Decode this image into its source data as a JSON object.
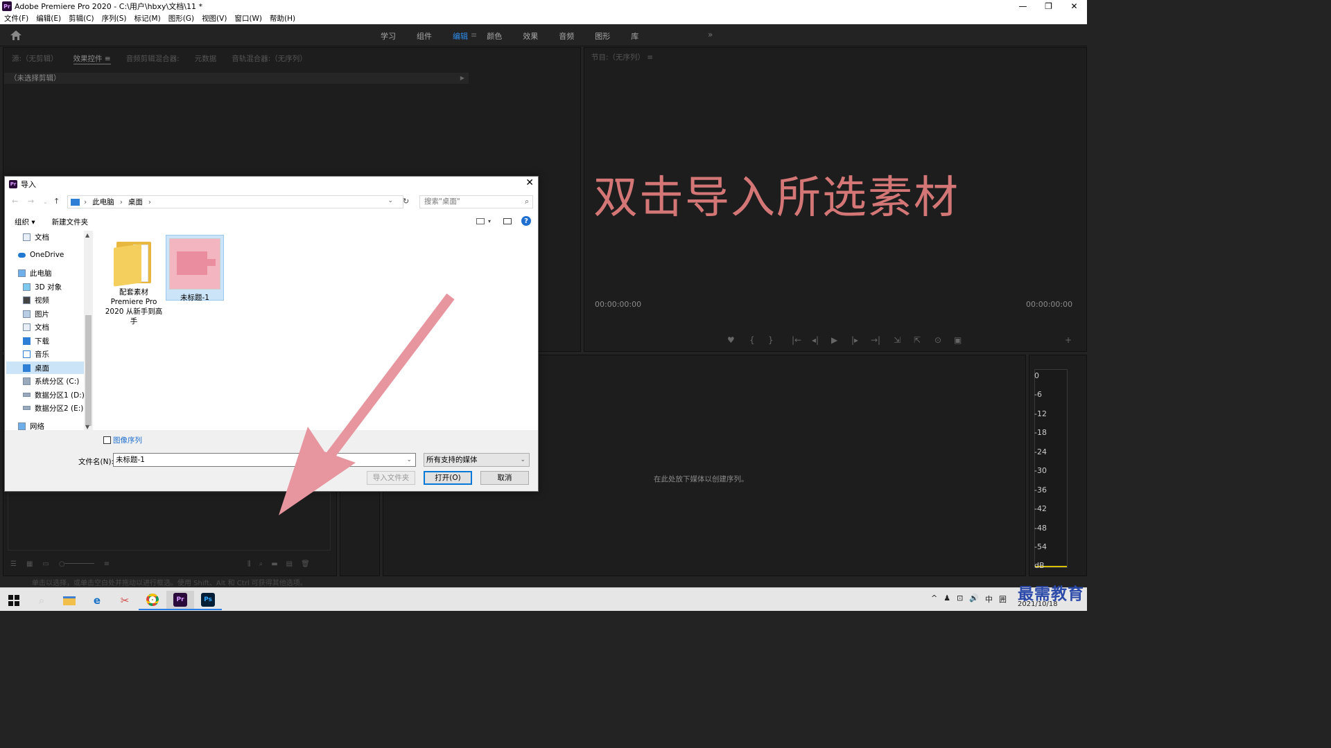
{
  "window": {
    "title": "Adobe Premiere Pro 2020 - C:\\用户\\hbxy\\文档\\11 *",
    "app_logo": "Pr",
    "controls": [
      "—",
      "❐",
      "✕"
    ]
  },
  "menu": [
    "文件(F)",
    "编辑(E)",
    "剪辑(C)",
    "序列(S)",
    "标记(M)",
    "图形(G)",
    "视图(V)",
    "窗口(W)",
    "帮助(H)"
  ],
  "workspaces": {
    "tabs": [
      "学习",
      "组件",
      "编辑",
      "颜色",
      "效果",
      "音频",
      "图形",
      "库"
    ],
    "active": "编辑",
    "active_marker": "≡",
    "more": "»"
  },
  "source_panel": {
    "tabs": [
      "源:（无剪辑）",
      "效果控件 ≡",
      "音频剪辑混合器:",
      "元数据",
      "音轨混合器:（无序列）"
    ],
    "active_tab": "效果控件 ≡",
    "no_clip": "（未选择剪辑）"
  },
  "program_panel": {
    "title": "节目:（无序列） ≡",
    "timecode_left": "00:00:00:00",
    "timecode_right": "00:00:00:00",
    "controls": [
      "♥",
      "{",
      "}",
      "|←",
      "◂|",
      "▶",
      "|▸",
      "→|",
      "⇲",
      "⇱",
      "⊙",
      "▣",
      "+"
    ]
  },
  "overlay_text": "双击导入所选素材",
  "timeline": {
    "drop_hint": "在此处放下媒体以创建序列。"
  },
  "vu_scale": [
    "0",
    "-6",
    "-12",
    "-18",
    "-24",
    "-30",
    "-36",
    "-42",
    "-48",
    "-54",
    "dB"
  ],
  "status_hint": "单击以选择，或单击空白处并拖动以进行框选。使用 Shift、Alt 和 Ctrl 可获得其他选项。",
  "dialog": {
    "title": "导入",
    "close": "✕",
    "address": [
      "此电脑",
      "桌面"
    ],
    "search_placeholder": "搜索\"桌面\"",
    "toolbar": {
      "organize": "组织 ▾",
      "new_folder": "新建文件夹",
      "help": "?"
    },
    "sidebar": [
      {
        "label": "文档",
        "icon": "document-icon"
      },
      {
        "label": "OneDrive",
        "icon": "cloud-icon"
      },
      {
        "label": "此电脑",
        "icon": "computer-icon"
      },
      {
        "label": "3D 对象",
        "icon": "cube-icon"
      },
      {
        "label": "视频",
        "icon": "video-icon"
      },
      {
        "label": "图片",
        "icon": "picture-icon"
      },
      {
        "label": "文档",
        "icon": "document-icon"
      },
      {
        "label": "下载",
        "icon": "download-icon"
      },
      {
        "label": "音乐",
        "icon": "music-icon"
      },
      {
        "label": "桌面",
        "icon": "desktop-icon",
        "selected": true
      },
      {
        "label": "系统分区 (C:)",
        "icon": "drive-icon"
      },
      {
        "label": "数据分区1 (D:)",
        "icon": "drive-icon"
      },
      {
        "label": "数据分区2 (E:)",
        "icon": "drive-icon"
      },
      {
        "label": "网络",
        "icon": "network-icon"
      }
    ],
    "files": [
      {
        "name": "配套素材 Premiere Pro 2020 从新手到高手",
        "type": "folder"
      },
      {
        "name": "未标题-1",
        "type": "image",
        "selected": true
      }
    ],
    "image_sequence_label": "图像序列",
    "filename_label": "文件名(N):",
    "filename_value": "未标题-1",
    "filetype_value": "所有支持的媒体",
    "buttons": {
      "import_folder": "导入文件夹",
      "open": "打开(O)",
      "cancel": "取消"
    }
  },
  "taskbar": {
    "apps": [
      "windows-start",
      "search",
      "file-explorer",
      "edge",
      "snipping",
      "chrome",
      "premiere",
      "photoshop"
    ],
    "premiere_label": "Pr",
    "photoshop_label": "Ps",
    "tray": [
      "^",
      "♟",
      "⊡",
      "🔊",
      "中",
      "囲"
    ],
    "date": "2021/10/18"
  },
  "watermark": "最需教育",
  "colors": {
    "accent": "#2d8ceb",
    "overlay": "#e47e7e",
    "arrow": "#e7959e",
    "dialog_selection": "#cce4f7"
  }
}
